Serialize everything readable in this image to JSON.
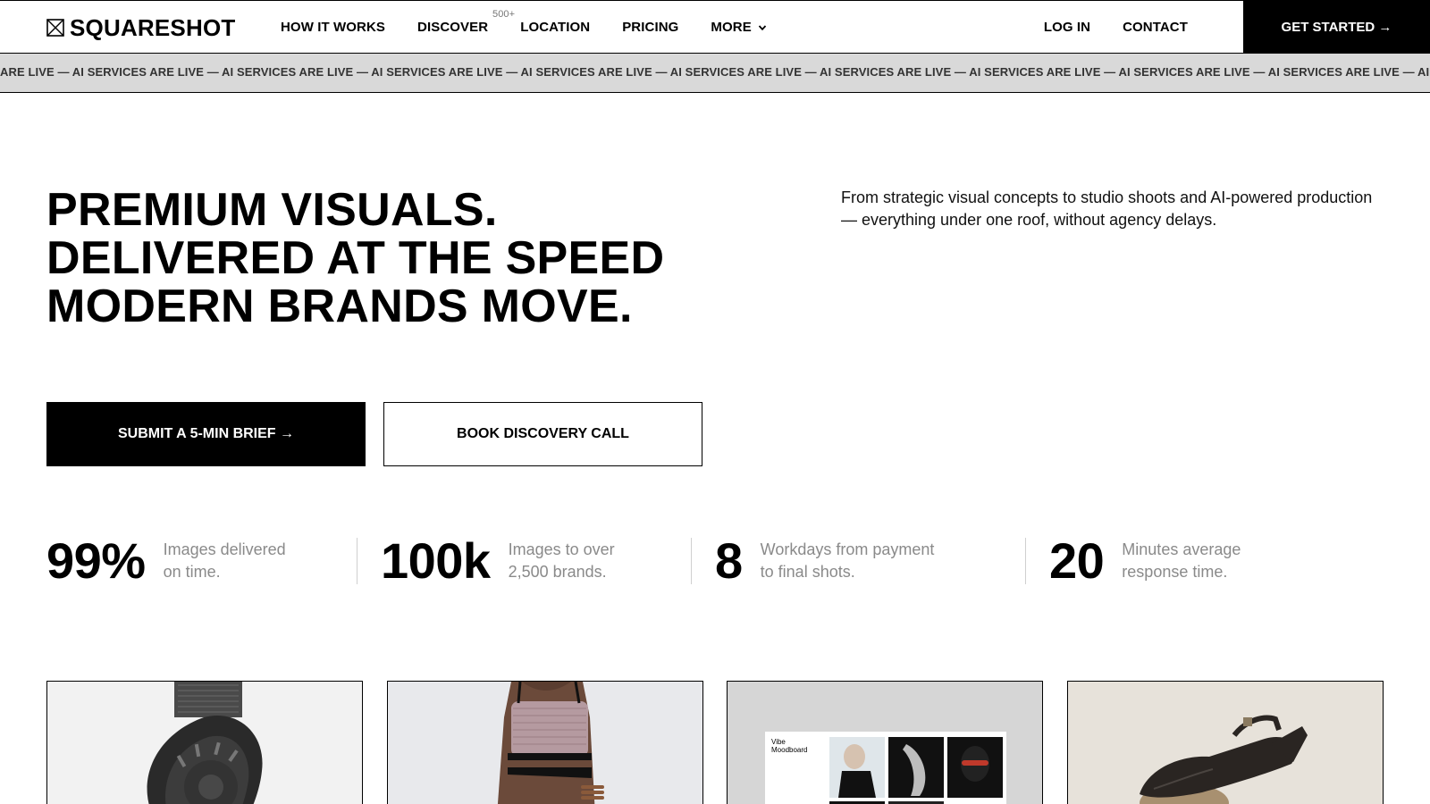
{
  "brand": {
    "name": "SQUARESHOT",
    "logo_icon": "crossed-square-icon"
  },
  "nav": {
    "links": [
      {
        "label": "HOW IT WORKS"
      },
      {
        "label": "DISCOVER",
        "badge": "500+"
      },
      {
        "label": "LOCATION"
      },
      {
        "label": "PRICING"
      },
      {
        "label": "MORE",
        "icon": "chevron-down-icon"
      }
    ],
    "login": "LOG IN",
    "contact": "CONTACT",
    "cta": "GET STARTED →"
  },
  "ticker": {
    "text": "S ARE LIVE — AI SERVICES ARE LIVE — AI SERVICES ARE LIVE — AI SERVICES ARE LIVE — AI SERVICES ARE LIVE — AI SERVICES ARE LIVE — AI SERVICES ARE LIVE — AI SERVICES ARE LIVE — AI SERVICES ARE LIVE — AI SERVICES ARE LIVE — AI SERVICES ARE LIVE — AI SERVIC"
  },
  "hero": {
    "title_lines": [
      "PREMIUM VISUALS.",
      "DELIVERED AT THE SPEED",
      "MODERN BRANDS MOVE."
    ],
    "description": "From strategic visual concepts to studio shoots and AI-powered production — everything under one roof, without agency delays.",
    "primary_button": "SUBMIT A 5-MIN BRIEF →",
    "secondary_button": "BOOK DISCOVERY CALL"
  },
  "stats": [
    {
      "value": "99%",
      "label": "Images delivered on time."
    },
    {
      "value": "100k",
      "label": "Images to over 2,500 brands."
    },
    {
      "value": "8",
      "label": "Workdays from payment to final shots."
    },
    {
      "value": "20",
      "label": "Minutes average response time."
    }
  ],
  "cards": [
    {
      "subject": "watch-image"
    },
    {
      "subject": "model-image"
    },
    {
      "subject": "moodboard-image",
      "caption_lines": [
        "Vibe",
        "Moodboard"
      ]
    },
    {
      "subject": "sandal-image"
    }
  ],
  "colors": {
    "primary": "#000000",
    "background": "#ffffff",
    "ticker_bg": "#d9d9d9",
    "muted_text": "#8a8a8a"
  }
}
